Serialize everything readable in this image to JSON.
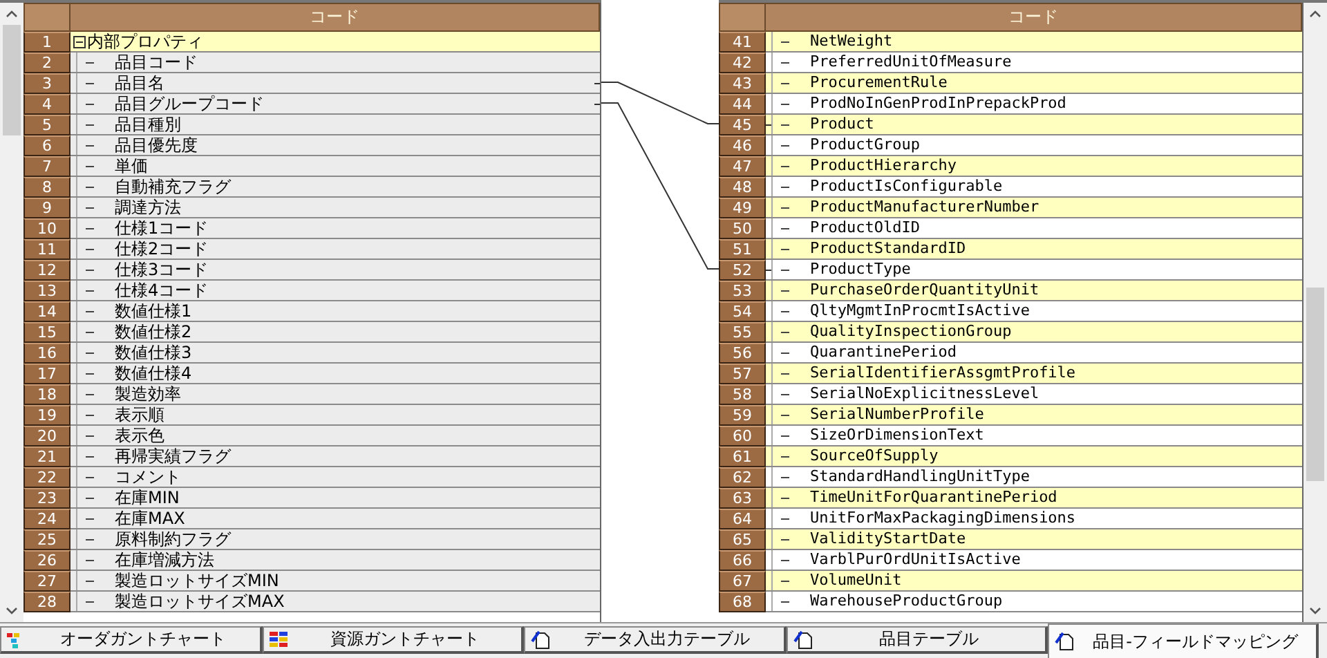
{
  "left_panel": {
    "header": "コード",
    "tree": [
      {
        "number": "1",
        "label": "内部プロパティ",
        "expanded": true,
        "highlighted": true,
        "linked": false,
        "children": [
          {
            "number": "2",
            "label": "品目コード",
            "highlighted": false,
            "linked": false
          },
          {
            "number": "3",
            "label": "品目名",
            "highlighted": false,
            "linked": true
          },
          {
            "number": "4",
            "label": "品目グループコード",
            "highlighted": false,
            "linked": true
          },
          {
            "number": "5",
            "label": "品目種別",
            "highlighted": false,
            "linked": false
          },
          {
            "number": "6",
            "label": "品目優先度",
            "highlighted": false,
            "linked": false
          },
          {
            "number": "7",
            "label": "単価",
            "highlighted": false,
            "linked": false
          },
          {
            "number": "8",
            "label": "自動補充フラグ",
            "highlighted": false,
            "linked": false
          },
          {
            "number": "9",
            "label": "調達方法",
            "highlighted": false,
            "linked": false
          },
          {
            "number": "10",
            "label": "仕様1コード",
            "highlighted": false,
            "linked": false
          },
          {
            "number": "11",
            "label": "仕様2コード",
            "highlighted": false,
            "linked": false
          },
          {
            "number": "12",
            "label": "仕様3コード",
            "highlighted": false,
            "linked": false
          },
          {
            "number": "13",
            "label": "仕様4コード",
            "highlighted": false,
            "linked": false
          },
          {
            "number": "14",
            "label": "数値仕様1",
            "highlighted": false,
            "linked": false
          },
          {
            "number": "15",
            "label": "数値仕様2",
            "highlighted": false,
            "linked": false
          },
          {
            "number": "16",
            "label": "数値仕様3",
            "highlighted": false,
            "linked": false
          },
          {
            "number": "17",
            "label": "数値仕様4",
            "highlighted": false,
            "linked": false
          },
          {
            "number": "18",
            "label": "製造効率",
            "highlighted": false,
            "linked": false
          },
          {
            "number": "19",
            "label": "表示順",
            "highlighted": false,
            "linked": false
          },
          {
            "number": "20",
            "label": "表示色",
            "highlighted": false,
            "linked": false
          },
          {
            "number": "21",
            "label": "再帰実績フラグ",
            "highlighted": false,
            "linked": false
          },
          {
            "number": "22",
            "label": "コメント",
            "highlighted": false,
            "linked": false
          },
          {
            "number": "23",
            "label": "在庫MIN",
            "highlighted": false,
            "linked": false
          },
          {
            "number": "24",
            "label": "在庫MAX",
            "highlighted": false,
            "linked": false
          },
          {
            "number": "25",
            "label": "原料制約フラグ",
            "highlighted": false,
            "linked": false
          },
          {
            "number": "26",
            "label": "在庫増減方法",
            "highlighted": false,
            "linked": false
          },
          {
            "number": "27",
            "label": "製造ロットサイズMIN",
            "highlighted": false,
            "linked": false
          },
          {
            "number": "28",
            "label": "製造ロットサイズMAX",
            "highlighted": false,
            "linked": false
          }
        ]
      }
    ]
  },
  "right_panel": {
    "header": "コード",
    "rows": [
      {
        "number": "41",
        "label": "NetWeight",
        "highlighted": true,
        "linked": false
      },
      {
        "number": "42",
        "label": "PreferredUnitOfMeasure",
        "highlighted": false,
        "linked": false
      },
      {
        "number": "43",
        "label": "ProcurementRule",
        "highlighted": true,
        "linked": false
      },
      {
        "number": "44",
        "label": "ProdNoInGenProdInPrepackProd",
        "highlighted": false,
        "linked": false
      },
      {
        "number": "45",
        "label": "Product",
        "highlighted": true,
        "linked": true
      },
      {
        "number": "46",
        "label": "ProductGroup",
        "highlighted": false,
        "linked": false
      },
      {
        "number": "47",
        "label": "ProductHierarchy",
        "highlighted": true,
        "linked": false
      },
      {
        "number": "48",
        "label": "ProductIsConfigurable",
        "highlighted": false,
        "linked": false
      },
      {
        "number": "49",
        "label": "ProductManufacturerNumber",
        "highlighted": true,
        "linked": false
      },
      {
        "number": "50",
        "label": "ProductOldID",
        "highlighted": false,
        "linked": false
      },
      {
        "number": "51",
        "label": "ProductStandardID",
        "highlighted": true,
        "linked": false
      },
      {
        "number": "52",
        "label": "ProductType",
        "highlighted": false,
        "linked": true
      },
      {
        "number": "53",
        "label": "PurchaseOrderQuantityUnit",
        "highlighted": true,
        "linked": false
      },
      {
        "number": "54",
        "label": "QltyMgmtInProcmtIsActive",
        "highlighted": false,
        "linked": false
      },
      {
        "number": "55",
        "label": "QualityInspectionGroup",
        "highlighted": true,
        "linked": false
      },
      {
        "number": "56",
        "label": "QuarantinePeriod",
        "highlighted": false,
        "linked": false
      },
      {
        "number": "57",
        "label": "SerialIdentifierAssgmtProfile",
        "highlighted": true,
        "linked": false
      },
      {
        "number": "58",
        "label": "SerialNoExplicitnessLevel",
        "highlighted": false,
        "linked": false
      },
      {
        "number": "59",
        "label": "SerialNumberProfile",
        "highlighted": true,
        "linked": false
      },
      {
        "number": "60",
        "label": "SizeOrDimensionText",
        "highlighted": false,
        "linked": false
      },
      {
        "number": "61",
        "label": "SourceOfSupply",
        "highlighted": true,
        "linked": false
      },
      {
        "number": "62",
        "label": "StandardHandlingUnitType",
        "highlighted": false,
        "linked": false
      },
      {
        "number": "63",
        "label": "TimeUnitForQuarantinePeriod",
        "highlighted": true,
        "linked": false
      },
      {
        "number": "64",
        "label": "UnitForMaxPackagingDimensions",
        "highlighted": false,
        "linked": false
      },
      {
        "number": "65",
        "label": "ValidityStartDate",
        "highlighted": true,
        "linked": false
      },
      {
        "number": "66",
        "label": "VarblPurOrdUnitIsActive",
        "highlighted": false,
        "linked": false
      },
      {
        "number": "67",
        "label": "VolumeUnit",
        "highlighted": true,
        "linked": false
      },
      {
        "number": "68",
        "label": "WarehouseProductGroup",
        "highlighted": false,
        "linked": false
      }
    ]
  },
  "tabs": [
    {
      "label": "オーダガントチャート",
      "kind": "gantt",
      "selected": false
    },
    {
      "label": "資源ガントチャート",
      "kind": "resource",
      "selected": false
    },
    {
      "label": "データ入出力テーブル",
      "kind": "table",
      "selected": false
    },
    {
      "label": "品目テーブル",
      "kind": "table",
      "selected": false
    },
    {
      "label": "品目-フィールドマッピング",
      "kind": "table",
      "selected": true
    }
  ]
}
